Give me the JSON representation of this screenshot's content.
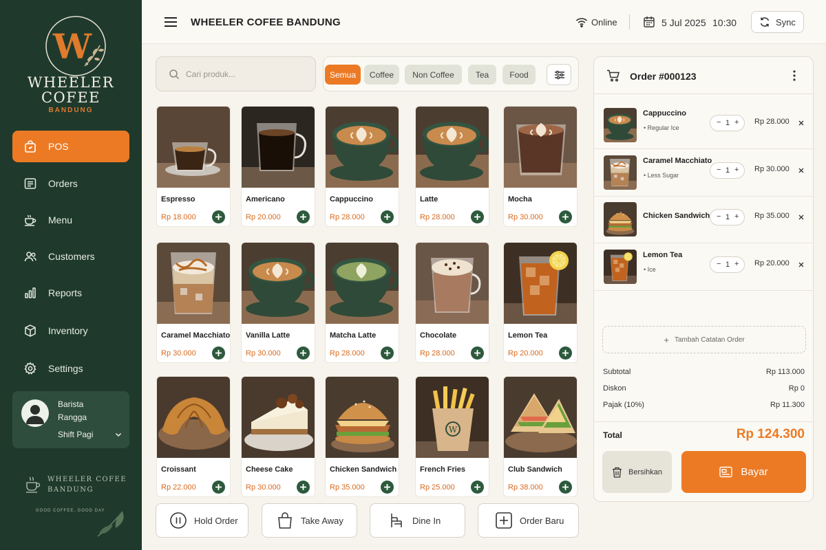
{
  "brand": {
    "name_line1": "WHEELER",
    "name_line2": "COFEE",
    "city": "BANDUNG",
    "footer_line1": "WHEELER COFEE",
    "footer_line2": "BANDUNG",
    "tagline": "GOOD COFFEE, GOOD DAY",
    "logo_letter": "W"
  },
  "colors": {
    "sidebar_bg": "#1f3a2c",
    "accent": "#ec7a25",
    "add_button": "#2d5a3c",
    "price_text": "#d86a1f"
  },
  "sidebar": {
    "items": [
      {
        "label": "POS",
        "icon": "shopping-bag-icon",
        "active": true
      },
      {
        "label": "Orders",
        "icon": "list-icon",
        "active": false
      },
      {
        "label": "Menu",
        "icon": "coffee-cup-icon",
        "active": false
      },
      {
        "label": "Customers",
        "icon": "users-icon",
        "active": false
      },
      {
        "label": "Reports",
        "icon": "bar-chart-icon",
        "active": false
      },
      {
        "label": "Inventory",
        "icon": "box-icon",
        "active": false
      },
      {
        "label": "Settings",
        "icon": "gear-icon",
        "active": false
      }
    ],
    "user": {
      "role": "Barista",
      "name": "Rangga",
      "shift": "Shift Pagi"
    }
  },
  "header": {
    "title": "WHEELER COFEE BANDUNG",
    "status": "Online",
    "date": "5 Jul 2025",
    "time": "10:30",
    "sync_label": "Sync"
  },
  "search": {
    "placeholder": "Cari produk...",
    "value": ""
  },
  "categories": [
    {
      "label": "Semua",
      "active": true
    },
    {
      "label": "Coffee",
      "active": false
    },
    {
      "label": "Non Coffee",
      "active": false
    },
    {
      "label": "Tea",
      "active": false
    },
    {
      "label": "Food",
      "active": false
    }
  ],
  "products": [
    {
      "name": "Espresso",
      "price": "Rp 18.000",
      "image": "espresso"
    },
    {
      "name": "Americano",
      "price": "Rp 20.000",
      "image": "americano"
    },
    {
      "name": "Cappuccino",
      "price": "Rp 28.000",
      "image": "latte-art-green"
    },
    {
      "name": "Latte",
      "price": "Rp 28.000",
      "image": "latte-art-green"
    },
    {
      "name": "Mocha",
      "price": "Rp 30.000",
      "image": "mocha"
    },
    {
      "name": "Caramel Macchiato",
      "price": "Rp 30.000",
      "image": "iced-caramel"
    },
    {
      "name": "Vanilla Latte",
      "price": "Rp 30.000",
      "image": "latte-art-green"
    },
    {
      "name": "Matcha Latte",
      "price": "Rp 28.000",
      "image": "matcha"
    },
    {
      "name": "Chocolate",
      "price": "Rp 28.000",
      "image": "chocolate"
    },
    {
      "name": "Lemon Tea",
      "price": "Rp 20.000",
      "image": "lemon-tea"
    },
    {
      "name": "Croissant",
      "price": "Rp 22.000",
      "image": "croissant"
    },
    {
      "name": "Cheese Cake",
      "price": "Rp 30.000",
      "image": "cheesecake"
    },
    {
      "name": "Chicken Sandwich",
      "price": "Rp 35.000",
      "image": "burger"
    },
    {
      "name": "French Fries",
      "price": "Rp 25.000",
      "image": "fries"
    },
    {
      "name": "Club Sandwich",
      "price": "Rp 38.000",
      "image": "club-sandwich"
    }
  ],
  "actions": [
    {
      "label": "Hold Order",
      "icon": "pause-icon"
    },
    {
      "label": "Take Away",
      "icon": "takeaway-bag-icon"
    },
    {
      "label": "Dine In",
      "icon": "chair-icon"
    },
    {
      "label": "Order Baru",
      "icon": "plus-square-icon"
    }
  ],
  "order": {
    "title": "Order #000123",
    "items": [
      {
        "name": "Cappuccino",
        "note": "Regular Ice",
        "qty": "1",
        "price": "Rp 28.000",
        "image": "latte-art-green"
      },
      {
        "name": "Caramel Macchiato",
        "note": "Less Sugar",
        "qty": "1",
        "price": "Rp 30.000",
        "image": "iced-caramel"
      },
      {
        "name": "Chicken Sandwich",
        "note": "",
        "qty": "1",
        "price": "Rp 35.000",
        "image": "burger"
      },
      {
        "name": "Lemon Tea",
        "note": "Ice",
        "qty": "1",
        "price": "Rp 20.000",
        "image": "lemon-tea"
      }
    ],
    "add_note_label": "Tambah Catatan Order",
    "summary": {
      "subtotal_label": "Subtotal",
      "subtotal": "Rp 113.000",
      "discount_label": "Diskon",
      "discount": "Rp 0",
      "tax_label": "Pajak (10%)",
      "tax": "Rp 11.300",
      "total_label": "Total",
      "total": "Rp 124.300"
    },
    "clear_label": "Bersihkan",
    "pay_label": "Bayar"
  }
}
